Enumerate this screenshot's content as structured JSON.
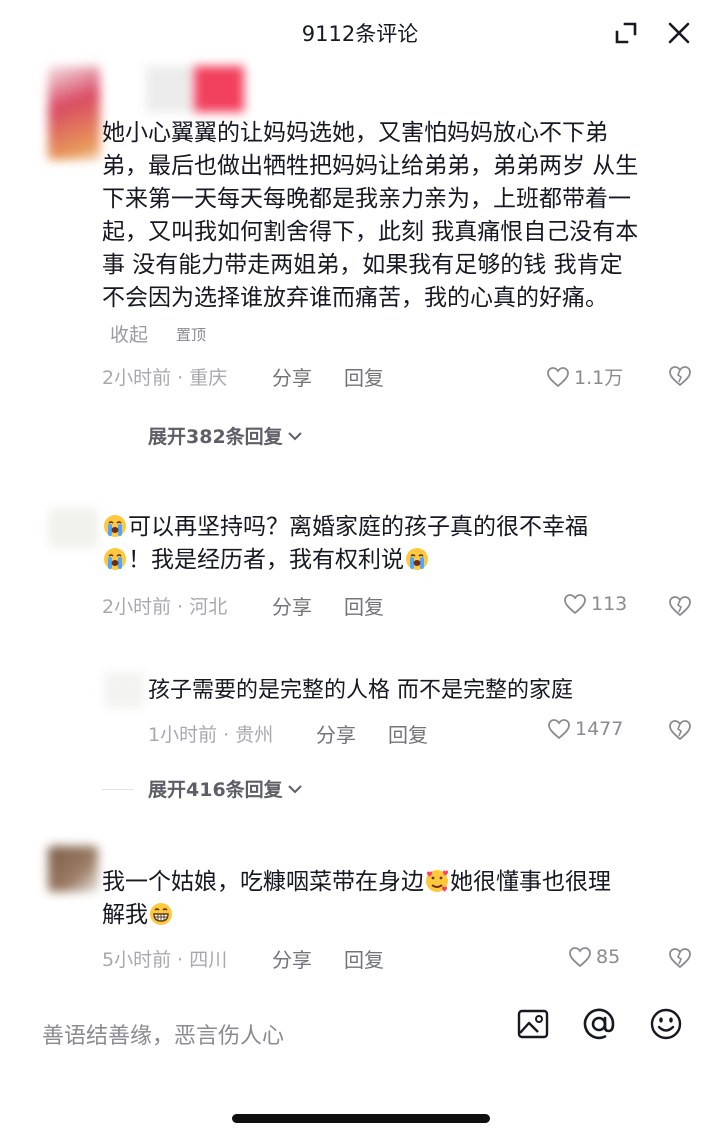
{
  "header": {
    "title": "9112条评论"
  },
  "comments": [
    {
      "text_lines": [
        "她小心翼翼的让妈妈选她，又害怕妈妈放心不下弟",
        "弟，最后也做出牺牲把妈妈让给弟弟，弟弟两岁 从生",
        "下来第一天每天每晚都是我亲力亲为，上班都带着一",
        "起，又叫我如何割舍得下，此刻 我真痛恨自己没有本",
        "事 没有能力带走两姐弟，如果我有足够的钱 我肯定",
        "不会因为选择谁放弃谁而痛苦，我的心真的好痛。"
      ],
      "collapse_label": "收起",
      "pin_label": "置顶",
      "time_location": "2小时前 · 重庆",
      "share_label": "分享",
      "reply_label": "回复",
      "likes": "1.1万",
      "expand_replies": "展开382条回复"
    },
    {
      "line1_text": "可以再坚持吗？离婚家庭的孩子真的很不幸福",
      "line2_text": "！我是经历者，我有权利说",
      "time_location": "2小时前 · 河北",
      "share_label": "分享",
      "reply_label": "回复",
      "likes": "113",
      "emoji": "loudly-crying-emoji"
    },
    {
      "text": "孩子需要的是完整的人格 而不是完整的家庭",
      "time_location": "1小时前 · 贵州",
      "share_label": "分享",
      "reply_label": "回复",
      "likes": "1477",
      "expand_replies": "展开416条回复"
    },
    {
      "line1_text": "我一个姑娘，吃糠咽菜带在身边",
      "line1_tail": "她很懂事也很理",
      "line2_text": "解我",
      "time_location": "5小时前 · 四川",
      "share_label": "分享",
      "reply_label": "回复",
      "likes": "85",
      "emoji1": "smiling-hearts-emoji",
      "emoji2": "grinning-emoji"
    }
  ],
  "input_bar": {
    "placeholder": "善语结善缘，恶言伤人心",
    "icons": [
      "image-icon",
      "at-icon",
      "emoji-icon"
    ]
  },
  "colors": {
    "text": "#161823",
    "secondary": "#a8a9ae",
    "action": "#73747a",
    "emoji_yellow": "#ffc83d"
  }
}
